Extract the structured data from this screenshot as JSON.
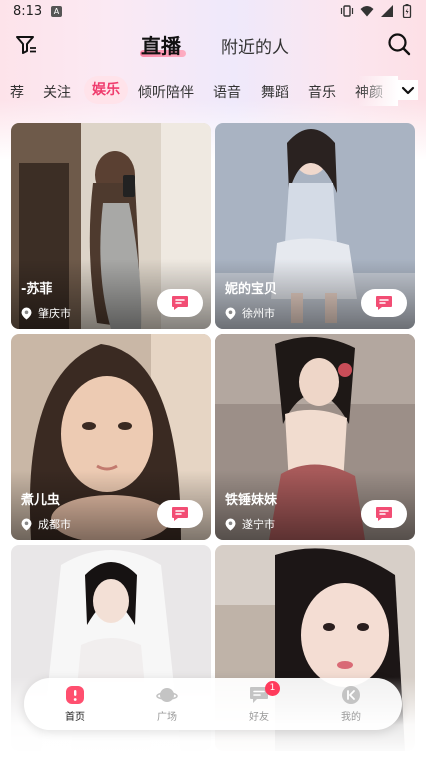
{
  "status_bar": {
    "time": "8:13",
    "notification_badge": "A"
  },
  "header": {
    "tabs": [
      {
        "label": "直播",
        "active": true
      },
      {
        "label": "附近的人",
        "active": false
      }
    ]
  },
  "categories": {
    "items": [
      "荐",
      "关注",
      "娱乐",
      "倾听陪伴",
      "语音",
      "舞蹈",
      "音乐",
      "神颜"
    ],
    "active": "娱乐"
  },
  "cards": [
    {
      "name": "-苏菲",
      "location": "肇庆市"
    },
    {
      "name": "妮的宝贝",
      "location": "徐州市"
    },
    {
      "name": "煮儿虫",
      "location": "成都市"
    },
    {
      "name": "铁锤妹妹",
      "location": "遂宁市"
    },
    {
      "name": "",
      "location": ""
    },
    {
      "name": "",
      "location": ""
    }
  ],
  "bottom_nav": {
    "items": [
      {
        "label": "首页",
        "icon": "home-icon",
        "active": true
      },
      {
        "label": "广场",
        "icon": "planet-icon",
        "active": false
      },
      {
        "label": "好友",
        "icon": "chat-icon",
        "active": false,
        "badge": "1"
      },
      {
        "label": "我的",
        "icon": "profile-icon",
        "active": false
      }
    ]
  },
  "colors": {
    "accent": "#ef3c6d",
    "accent_light": "#ffe3ea",
    "badge": "#ff3b5c"
  }
}
